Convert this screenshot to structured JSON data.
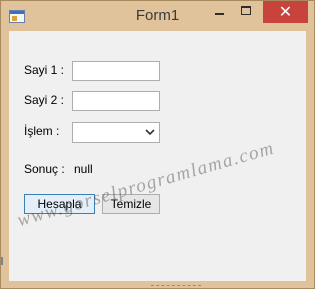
{
  "window": {
    "title": "Form1",
    "close_glyph": "✕",
    "controls": [
      "minimize-icon",
      "maximize-icon",
      "close-icon"
    ]
  },
  "form": {
    "sayi1_label": "Sayi 1 :",
    "sayi1_value": "",
    "sayi2_label": "Sayi 2 :",
    "sayi2_value": "",
    "islem_label": "İşlem :",
    "islem_value": "",
    "sonuc_label": "Sonuç :",
    "sonuc_value": "null",
    "hesapla_label": "Hesapla",
    "temizle_label": "Temizle"
  },
  "watermark": "www.gorselprogramlama.com",
  "colors": {
    "frame": "#e1c39b",
    "client": "#f0f0f0",
    "close_button": "#c7433c",
    "default_button_border": "#3c7fb1"
  }
}
